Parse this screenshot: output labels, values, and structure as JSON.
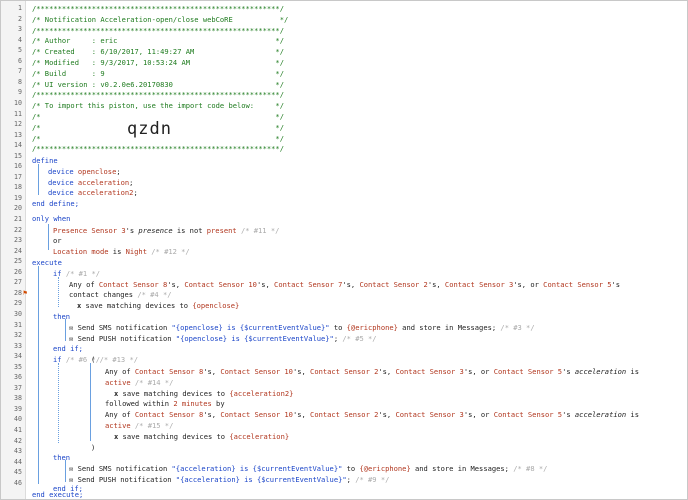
{
  "line_numbers": [
    "1",
    "2",
    "3",
    "4",
    "5",
    "6",
    "7",
    "8",
    "9",
    "10",
    "11",
    "12",
    "13",
    "14",
    "15",
    "16",
    "17",
    "18",
    "19",
    "20",
    "21",
    "22",
    "23",
    "24",
    "25",
    "26",
    "27",
    "28",
    "29",
    "30",
    "31",
    "32",
    "33",
    "34",
    "35",
    "36",
    "37",
    "38",
    "39",
    "40",
    "41",
    "42",
    "43",
    "44",
    "45",
    "46"
  ],
  "flag_glyph": "⚑",
  "header": {
    "stars": "/*********************************************************/",
    "title": "/* Notification Acceleration-open/close webCoRE           */",
    "author": "/* Author     : eric                                     */",
    "created": "/* Created    : 6/10/2017, 11:49:27 AM                   */",
    "modified": "/* Modified   : 9/3/2017, 10:53:24 AM                    */",
    "build": "/* Build      : 9                                        */",
    "ui_version": "/* UI version : v0.2.0e6.20170830                        */",
    "stars2": "/*********************************************************/",
    "import": "/* To import this piston, use the import code below:     */",
    "blank1": "/*                                                       */",
    "blank2": "/*                                                       */",
    "blank3": "/*                                                       */",
    "stars3": "/*********************************************************/",
    "import_code": "qzdn"
  },
  "define": {
    "kw": "define",
    "devices": [
      {
        "kw": "device",
        "name": "openclose",
        "end": ";"
      },
      {
        "kw": "device",
        "name": "acceleration",
        "end": ";"
      },
      {
        "kw": "device",
        "name": "acceleration2",
        "end": ";"
      }
    ],
    "end": "end define;"
  },
  "only_when": {
    "kw": "only when",
    "c1_dev": "Presence Sensor 3",
    "c1_mid": "'s ",
    "c1_attr": "presence",
    "c1_op": " is not ",
    "c1_val": "present",
    "c1_id": "/* #11 */",
    "or": "or",
    "c2_a": "Location mode",
    "c2_b": " is ",
    "c2_val": "Night",
    "c2_id": "/* #12 */"
  },
  "execute": {
    "kw": "execute",
    "if1": "if",
    "if1_id": "/* #1 */",
    "any_prefix": "Any of ",
    "sensors1": [
      "Contact Sensor 8",
      "Contact Sensor 10",
      "Contact Sensor 7",
      "Contact Sensor 2",
      "Contact Sensor 3",
      "Contact Sensor 5"
    ],
    "sep": "'s, ",
    "or_sep": "'s, or ",
    "last_sep": "'s",
    "contact_changes": "contact changes",
    "cc_id": "/* #4 */",
    "save1_icon": "x",
    "save1_text": " save matching devices to ",
    "save1_var": "{openclose}",
    "then1": "then",
    "sms_prefix": "Send SMS notification ",
    "sms1_str": "\"{openclose} is {$currentEventValue}\"",
    "to": " to ",
    "phone": "{@ericphone}",
    "store": " and store in Messages;",
    "sms1_id": "/* #3 */",
    "push_prefix": "Send PUSH notification ",
    "push1_str": "\"{openclose} is {$currentEventValue}\"",
    "semi": ";",
    "push1_id": "/* #5 */",
    "endif1": "end if;",
    "if2": "if",
    "if2_id": "/* #6 */",
    "paren_open": "(",
    "grp_id": "/* #13 */",
    "sensors2": [
      "Contact Sensor 8",
      "Contact Sensor 10",
      "Contact Sensor 2",
      "Contact Sensor 3",
      "Contact Sensor 5"
    ],
    "accel_attr": "acceleration",
    "is_word": " is",
    "active": "active",
    "active1_id": "/* #14 */",
    "save2_var": "{acceleration2}",
    "followed_a": "followed within ",
    "followed_b": "2 minutes",
    "followed_c": " by",
    "active2_id": "/* #15 */",
    "save3_var": "{acceleration}",
    "paren_close": ")",
    "then2": "then",
    "sms2_str": "\"{acceleration} is {$currentEventValue}\"",
    "sms2_id": "/* #8 */",
    "push2_str": "\"{acceleration} is {$currentEventValue}\"",
    "push2_id": "/* #9 */",
    "endif2": "end if;",
    "end": "end execute;"
  }
}
